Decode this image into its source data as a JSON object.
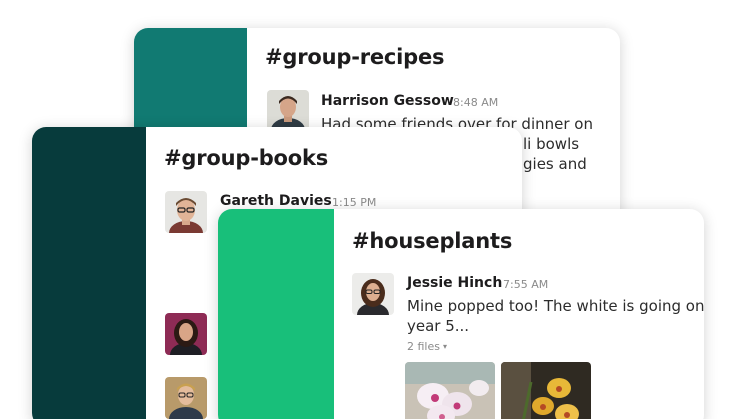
{
  "cards": {
    "recipes": {
      "channel": "#group-recipes",
      "message": {
        "author": "Harrison Gessow",
        "time": "8:48 AM",
        "lines": [
          "Had some friends over for dinner on",
          "li bowls",
          "gies and"
        ]
      }
    },
    "books": {
      "channel": "#group-books",
      "message": {
        "author": "Gareth Davies",
        "time": "1:15 PM"
      }
    },
    "houseplants": {
      "channel": "#houseplants",
      "message": {
        "author": "Jessie Hinch",
        "time": "7:55 AM",
        "lines": [
          "Mine popped too! The white is going on",
          "year 5..."
        ],
        "files_label": "2 files",
        "files_caret": "▾"
      }
    }
  },
  "colors": {
    "recipes_rail": "#117a72",
    "books_rail": "#073b3c",
    "houseplants_rail": "#18bf7a"
  }
}
